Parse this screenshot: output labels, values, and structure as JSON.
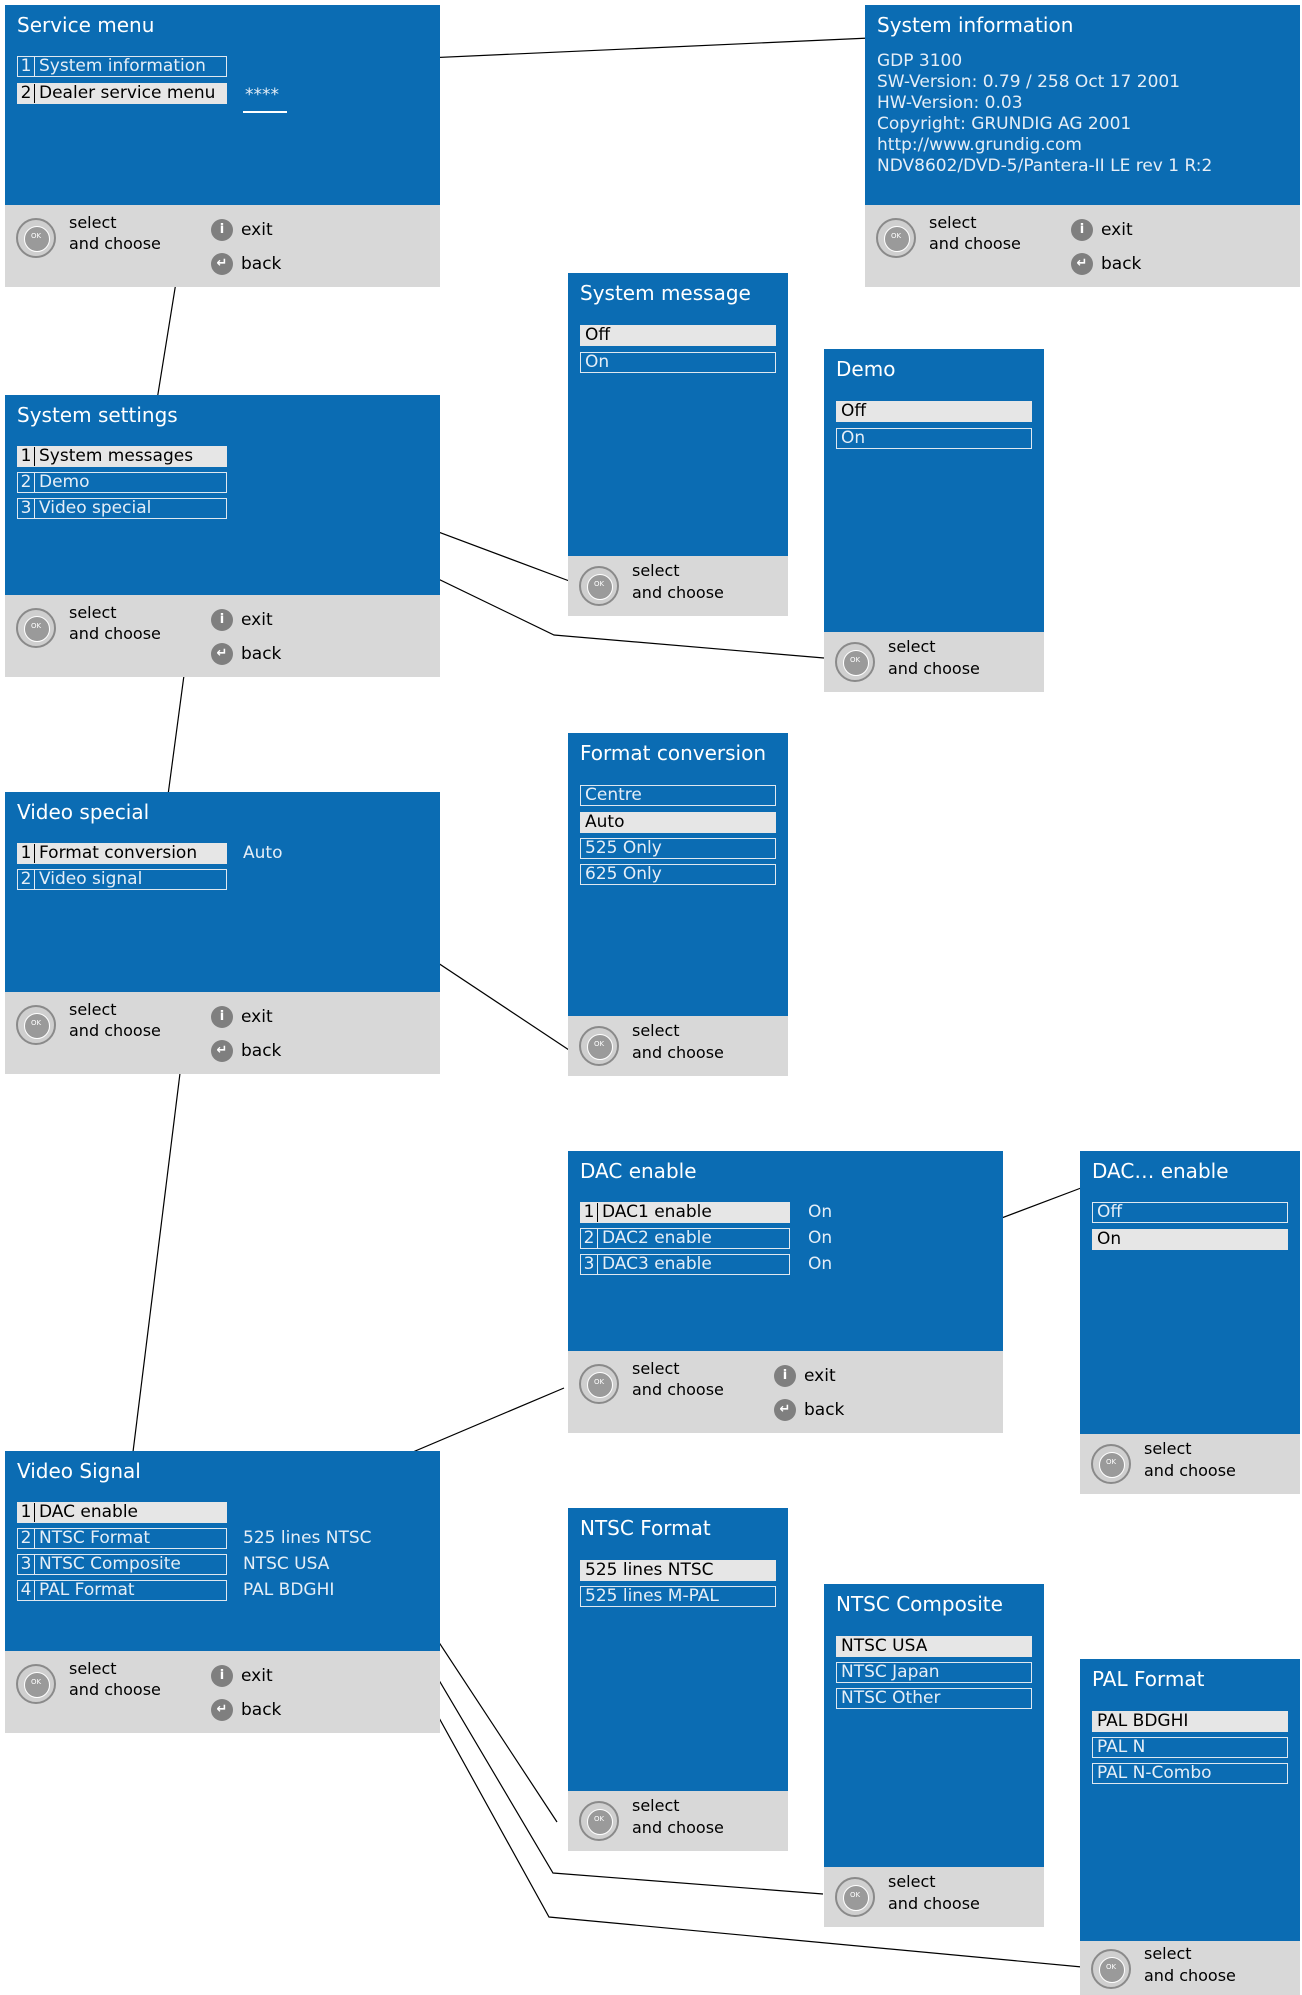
{
  "footer": {
    "select": "select",
    "choose": "and choose",
    "exit": "exit",
    "back": "back",
    "ok": "OK"
  },
  "service_menu": {
    "title": "Service menu",
    "items": [
      {
        "num": "1",
        "label": "System information"
      },
      {
        "num": "2",
        "label": "Dealer service menu"
      }
    ],
    "password": "****"
  },
  "system_information": {
    "title": "System information",
    "lines": [
      "GDP 3100",
      "SW-Version:   0.79 / 258 Oct 17 2001",
      "HW-Version:  0.03",
      "Copyright: GRUNDIG AG 2001",
      "http://www.grundig.com",
      "NDV8602/DVD-5/Pantera-II LE rev 1 R:2"
    ]
  },
  "system_message": {
    "title": "System message",
    "options": [
      "Off",
      "On"
    ]
  },
  "demo": {
    "title": "Demo",
    "options": [
      "Off",
      "On"
    ]
  },
  "system_settings": {
    "title": "System settings",
    "items": [
      {
        "num": "1",
        "label": "System messages"
      },
      {
        "num": "2",
        "label": "Demo"
      },
      {
        "num": "3",
        "label": "Video special"
      }
    ]
  },
  "format_conversion": {
    "title": "Format conversion",
    "options": [
      "Centre",
      "Auto",
      "525 Only",
      "625 Only"
    ]
  },
  "video_special": {
    "title": "Video special",
    "items": [
      {
        "num": "1",
        "label": "Format conversion",
        "value": "Auto"
      },
      {
        "num": "2",
        "label": "Video signal",
        "value": ""
      }
    ]
  },
  "dac_enable": {
    "title": "DAC enable",
    "items": [
      {
        "num": "1",
        "label": "DAC1  enable",
        "value": "On"
      },
      {
        "num": "2",
        "label": "DAC2  enable",
        "value": "On"
      },
      {
        "num": "3",
        "label": "DAC3  enable",
        "value": "On"
      }
    ]
  },
  "dac_x_enable": {
    "title": "DAC… enable",
    "options": [
      "Off",
      "On"
    ]
  },
  "video_signal": {
    "title": "Video Signal",
    "items": [
      {
        "num": "1",
        "label": "DAC enable",
        "value": ""
      },
      {
        "num": "2",
        "label": "NTSC  Format",
        "value": "525 lines NTSC"
      },
      {
        "num": "3",
        "label": "NTSC  Composite",
        "value": "NTSC  USA"
      },
      {
        "num": "4",
        "label": "PAL  Format",
        "value": "PAL  BDGHI"
      }
    ]
  },
  "ntsc_format": {
    "title": "NTSC Format",
    "options": [
      "525 lines NTSC",
      "525 lines M-PAL"
    ]
  },
  "ntsc_composite": {
    "title": "NTSC Composite",
    "options": [
      "NTSC  USA",
      "NTSC  Japan",
      "NTSC  Other"
    ]
  },
  "pal_format": {
    "title": "PAL Format",
    "options": [
      "PAL  BDGHI",
      "PAL  N",
      "PAL  N-Combo"
    ]
  }
}
